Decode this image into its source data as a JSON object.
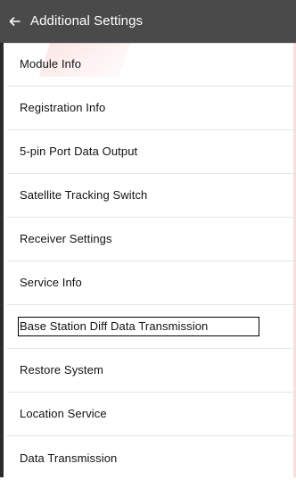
{
  "header": {
    "title": "Additional Settings",
    "back_icon": "back-arrow-icon"
  },
  "menu": {
    "items": [
      {
        "label": "Module Info"
      },
      {
        "label": "Registration Info"
      },
      {
        "label": "5-pin Port Data Output"
      },
      {
        "label": "Satellite Tracking Switch"
      },
      {
        "label": "Receiver Settings"
      },
      {
        "label": "Service Info"
      },
      {
        "label": "Base Station Diff Data Transmission"
      },
      {
        "label": "Restore System"
      },
      {
        "label": "Location Service"
      },
      {
        "label": "Data Transmission"
      }
    ]
  },
  "colors": {
    "header_background": "#4a4a4a",
    "header_text": "#ffffff",
    "divider": "#e4e4e4",
    "text": "#111111",
    "highlight_border": "#000000"
  }
}
